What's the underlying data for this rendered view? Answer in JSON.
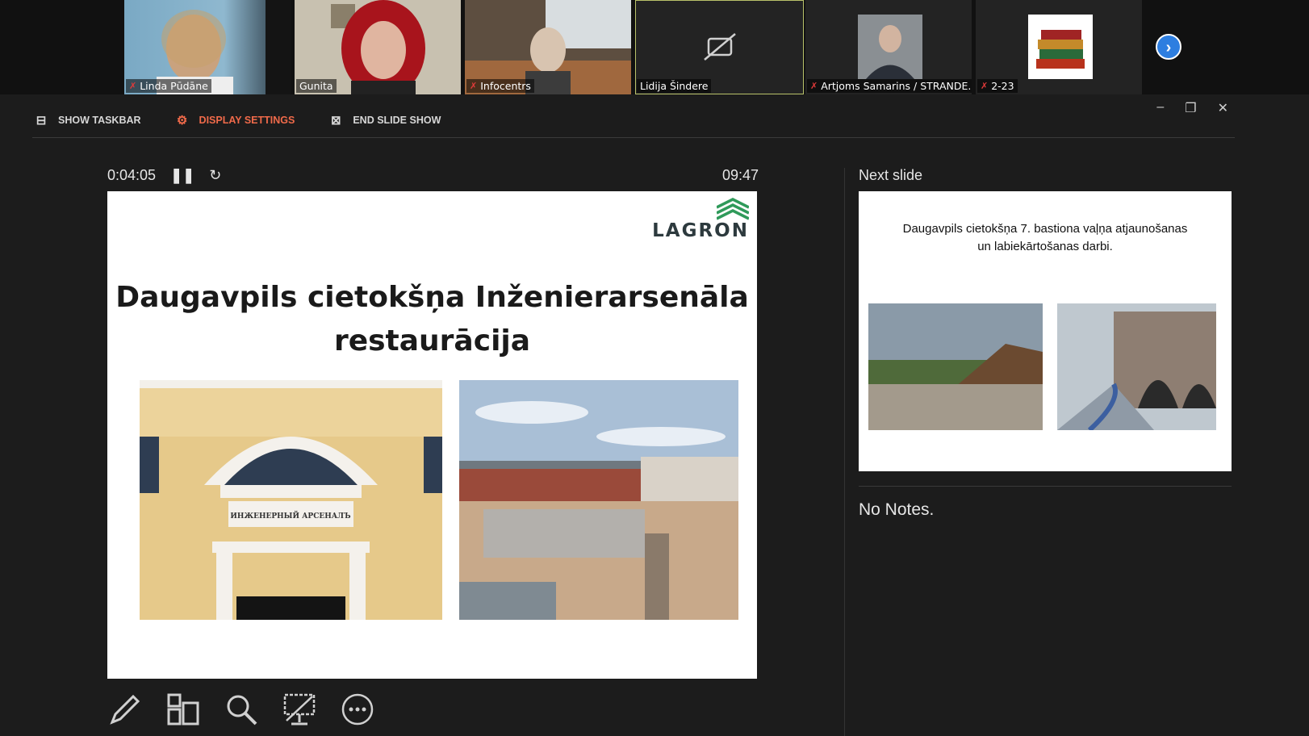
{
  "participants": [
    {
      "name": "Linda Pūdāne",
      "muted": true
    },
    {
      "name": "Gunita",
      "muted": false
    },
    {
      "name": "Infocentrs",
      "muted": true
    },
    {
      "name": "Lidija Šindere",
      "muted": false
    },
    {
      "name": "Artjoms Samarins / STRANDE...",
      "muted": true
    },
    {
      "name": "2-23",
      "muted": true
    }
  ],
  "toolbar": {
    "show_taskbar": "SHOW TASKBAR",
    "display_settings": "DISPLAY SETTINGS",
    "end_slide_show": "END SLIDE SHOW"
  },
  "presenter": {
    "elapsed": "0:04:05",
    "clock": "09:47",
    "next_slide_label": "Next slide",
    "notes": "No Notes."
  },
  "current_slide": {
    "logo": "LAGRON",
    "title_line1": "Daugavpils cietokšņa Inženierarsenāla",
    "title_line2": "restaurācija",
    "building_sign": "ИНЖЕНЕРНЫЙ АРСЕНАЛЪ"
  },
  "next_slide": {
    "title_line1": "Daugavpils cietokšņa 7. bastiona vaļņa atjaunošanas",
    "title_line2": "un labiekārtošanas darbi."
  },
  "colors": {
    "accent": "#f06a4a",
    "background": "#1c1c1c",
    "nav_button": "#2d7ee0"
  }
}
